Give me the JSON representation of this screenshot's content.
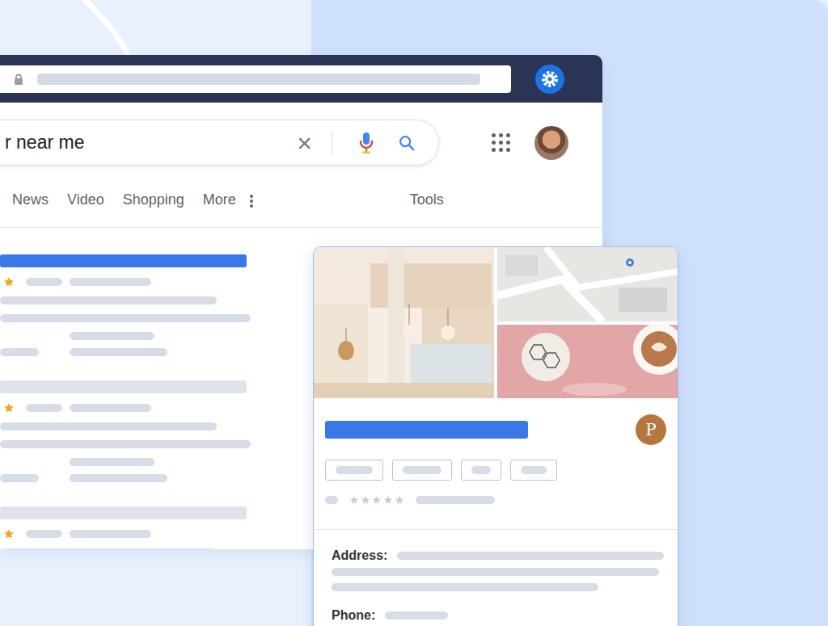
{
  "search": {
    "query": "r near me",
    "clear_icon": "×"
  },
  "tabs": [
    {
      "label": "News",
      "selected": false
    },
    {
      "label": "Video",
      "selected": false
    },
    {
      "label": "Shopping",
      "selected": false
    },
    {
      "label": "More",
      "selected": false
    }
  ],
  "tools": {
    "label": "Tools"
  },
  "results": [
    {
      "highlighted": true,
      "stars": 1
    },
    {
      "highlighted": false,
      "stars": 1
    },
    {
      "highlighted": false,
      "stars": 1
    }
  ],
  "profile": {
    "logo_letter": "P",
    "stars": 0,
    "fields": [
      {
        "label": "Address:",
        "kind": "multiline"
      },
      {
        "label": "Phone:",
        "kind": "single"
      }
    ]
  }
}
